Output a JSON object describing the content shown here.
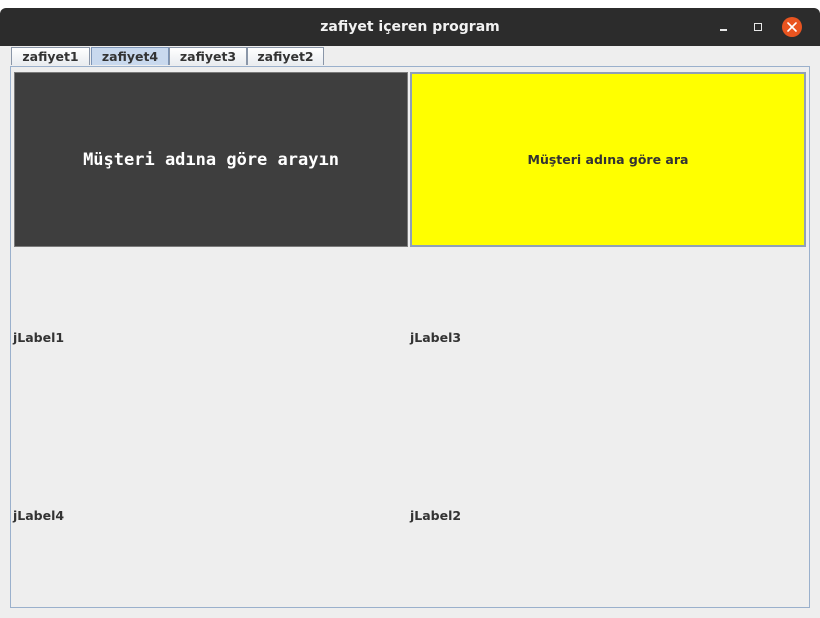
{
  "window": {
    "title": "zafiyet içeren program"
  },
  "controls": {
    "minimize_icon": "minimize-icon",
    "maximize_icon": "maximize-icon",
    "close_icon": "close-icon",
    "close_color": "#e95420"
  },
  "tabs": [
    {
      "label": "zafiyet1",
      "selected": false
    },
    {
      "label": "zafiyet4",
      "selected": true
    },
    {
      "label": "zafiyet3",
      "selected": false
    },
    {
      "label": "zafiyet2",
      "selected": false
    }
  ],
  "panel": {
    "heading_label": "Müşteri adına göre arayın",
    "search_button": "Müşteri adına göre ara",
    "search_button_color": "#ffff00",
    "heading_bg_color": "#3e3e3e",
    "labels": {
      "jlabel1": "jLabel1",
      "jlabel3": "jLabel3",
      "jlabel4": "jLabel4",
      "jlabel2": "jLabel2"
    }
  }
}
